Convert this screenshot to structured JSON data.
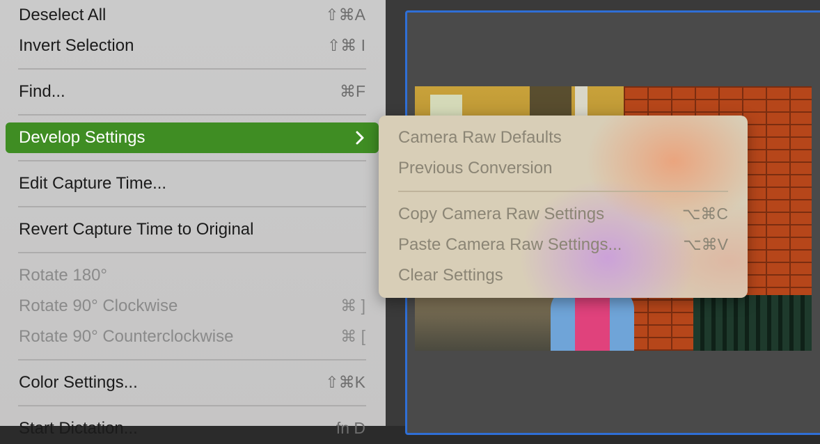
{
  "menu": {
    "items": [
      {
        "label": "Deselect All",
        "shortcut": "⇧⌘A"
      },
      {
        "label": "Invert Selection",
        "shortcut": "⇧⌘ I"
      },
      {
        "label": "Find...",
        "shortcut": "⌘F"
      },
      {
        "label": "Develop Settings",
        "shortcut": ""
      },
      {
        "label": "Edit Capture Time...",
        "shortcut": ""
      },
      {
        "label": "Revert Capture Time to Original",
        "shortcut": ""
      },
      {
        "label": "Rotate 180°",
        "shortcut": ""
      },
      {
        "label": "Rotate 90° Clockwise",
        "shortcut": "⌘ ]"
      },
      {
        "label": "Rotate 90° Counterclockwise",
        "shortcut": "⌘ ["
      },
      {
        "label": "Color Settings...",
        "shortcut": "⇧⌘K"
      },
      {
        "label": "Start Dictation...",
        "shortcut": "fn D"
      }
    ]
  },
  "submenu": {
    "items": [
      {
        "label": "Camera Raw Defaults",
        "shortcut": ""
      },
      {
        "label": "Previous Conversion",
        "shortcut": ""
      },
      {
        "label": "Copy Camera Raw Settings",
        "shortcut": "⌥⌘C"
      },
      {
        "label": "Paste Camera Raw Settings...",
        "shortcut": "⌥⌘V"
      },
      {
        "label": "Clear Settings",
        "shortcut": ""
      }
    ]
  },
  "colors": {
    "highlight": "#3f8d23",
    "viewer_border": "#2f6fd6"
  }
}
